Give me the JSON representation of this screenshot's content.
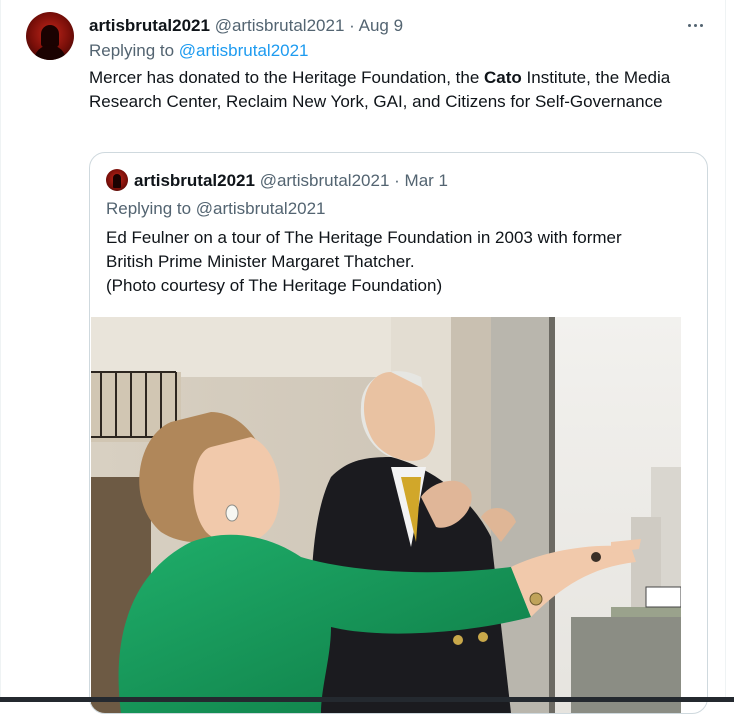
{
  "tweet": {
    "display_name": "artisbrutal2021",
    "handle": "@artisbrutal2021",
    "separator": "·",
    "date": "Aug 9",
    "replying_prefix": "Replying to",
    "replying_to": "@artisbrutal2021",
    "text_part1": "Mercer has donated to the Heritage Foundation, the ",
    "text_bold": "Cato",
    "text_part2": " Institute, the Media Research Center, Reclaim New York, GAI, and Citizens for Self-Governance"
  },
  "quoted_tweet": {
    "display_name": "artisbrutal2021",
    "handle": "@artisbrutal2021",
    "separator": "·",
    "date": "Mar 1",
    "replying_prefix": "Replying to",
    "replying_to": "@artisbrutal2021",
    "text_lines": [
      "Ed Feulner on a tour of The Heritage Foundation in 2003 with former",
      "British Prime Minister Margaret Thatcher.",
      "(Photo courtesy of The Heritage Foundation)"
    ]
  },
  "icons": {
    "more": "more-horizontal-icon",
    "avatar": "user-avatar",
    "photo": "photo"
  },
  "colors": {
    "link": "#1d9bf0",
    "muted": "#536471",
    "text": "#0f1419",
    "border": "#cfd9de"
  }
}
